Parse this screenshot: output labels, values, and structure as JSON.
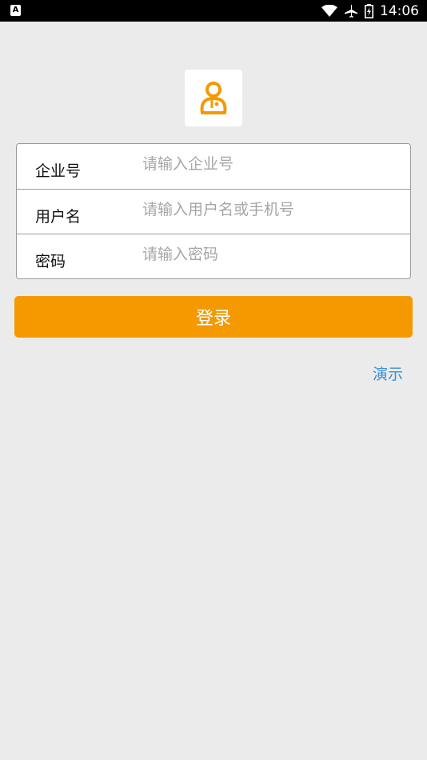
{
  "status_bar": {
    "left_icon": "A",
    "time": "14:06",
    "icons": [
      "wifi-icon",
      "airplane-icon",
      "battery-icon"
    ]
  },
  "logo": {
    "icon": "user-icon",
    "color": "#f49a00"
  },
  "form": {
    "company": {
      "label": "企业号",
      "placeholder": "请输入企业号",
      "value": ""
    },
    "username": {
      "label": "用户名",
      "placeholder": "请输入用户名或手机号",
      "value": ""
    },
    "password": {
      "label": "密码",
      "placeholder": "请输入密码",
      "value": ""
    }
  },
  "login_button": {
    "label": "登录",
    "color": "#f49a00"
  },
  "demo_link": {
    "label": "演示",
    "color": "#3a8fd6"
  }
}
